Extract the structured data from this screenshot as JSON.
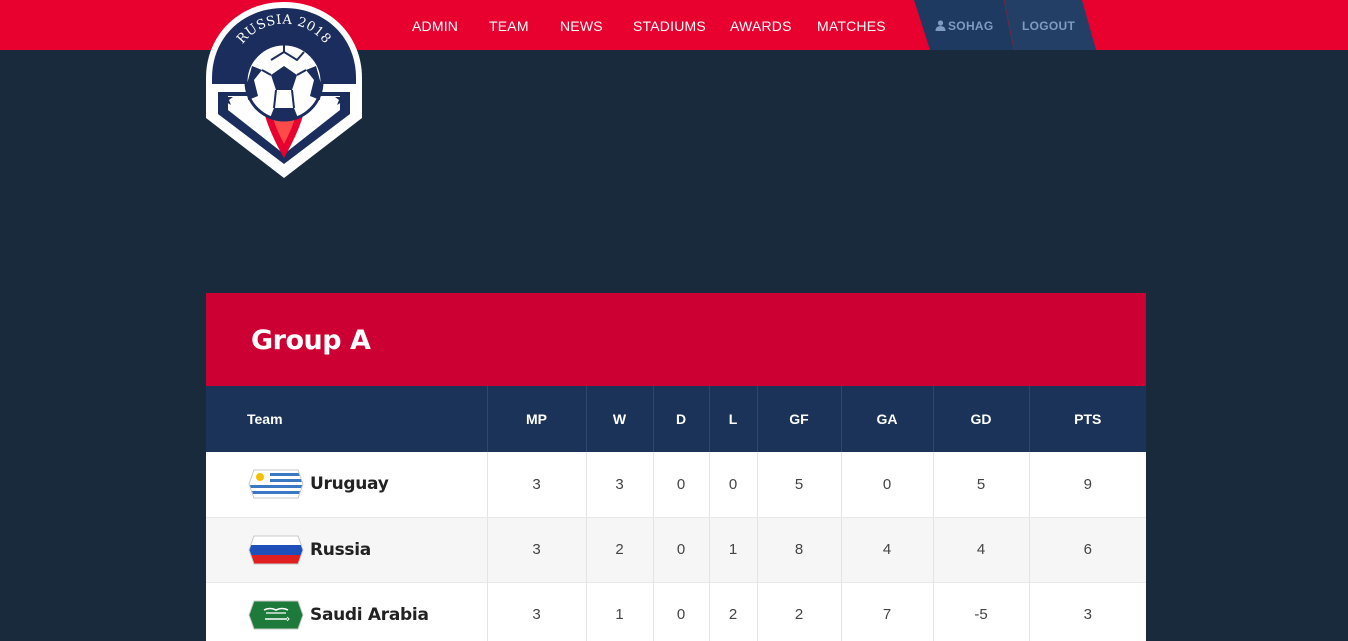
{
  "logo": {
    "text": "RUSSIA 2018"
  },
  "nav": {
    "items": [
      "ADMIN",
      "TEAM",
      "NEWS",
      "STADIUMS",
      "AWARDS",
      "MATCHES"
    ]
  },
  "user": {
    "name": "SOHAG",
    "logout": "LOGOUT"
  },
  "colors": {
    "brand_red": "#e8002e",
    "header_red": "#cc0033",
    "navy": "#1b3358",
    "page_bg": "#1a2a3d"
  },
  "group": {
    "title": "Group A",
    "columns": [
      "Team",
      "MP",
      "W",
      "D",
      "L",
      "GF",
      "GA",
      "GD",
      "PTS"
    ],
    "rows": [
      {
        "team": "Uruguay",
        "flag": "uruguay-flag-icon",
        "mp": "3",
        "w": "3",
        "d": "0",
        "l": "0",
        "gf": "5",
        "ga": "0",
        "gd": "5",
        "pts": "9"
      },
      {
        "team": "Russia",
        "flag": "russia-flag-icon",
        "mp": "3",
        "w": "2",
        "d": "0",
        "l": "1",
        "gf": "8",
        "ga": "4",
        "gd": "4",
        "pts": "6"
      },
      {
        "team": "Saudi Arabia",
        "flag": "saudi-arabia-flag-icon",
        "mp": "3",
        "w": "1",
        "d": "0",
        "l": "2",
        "gf": "2",
        "ga": "7",
        "gd": "-5",
        "pts": "3"
      }
    ]
  }
}
